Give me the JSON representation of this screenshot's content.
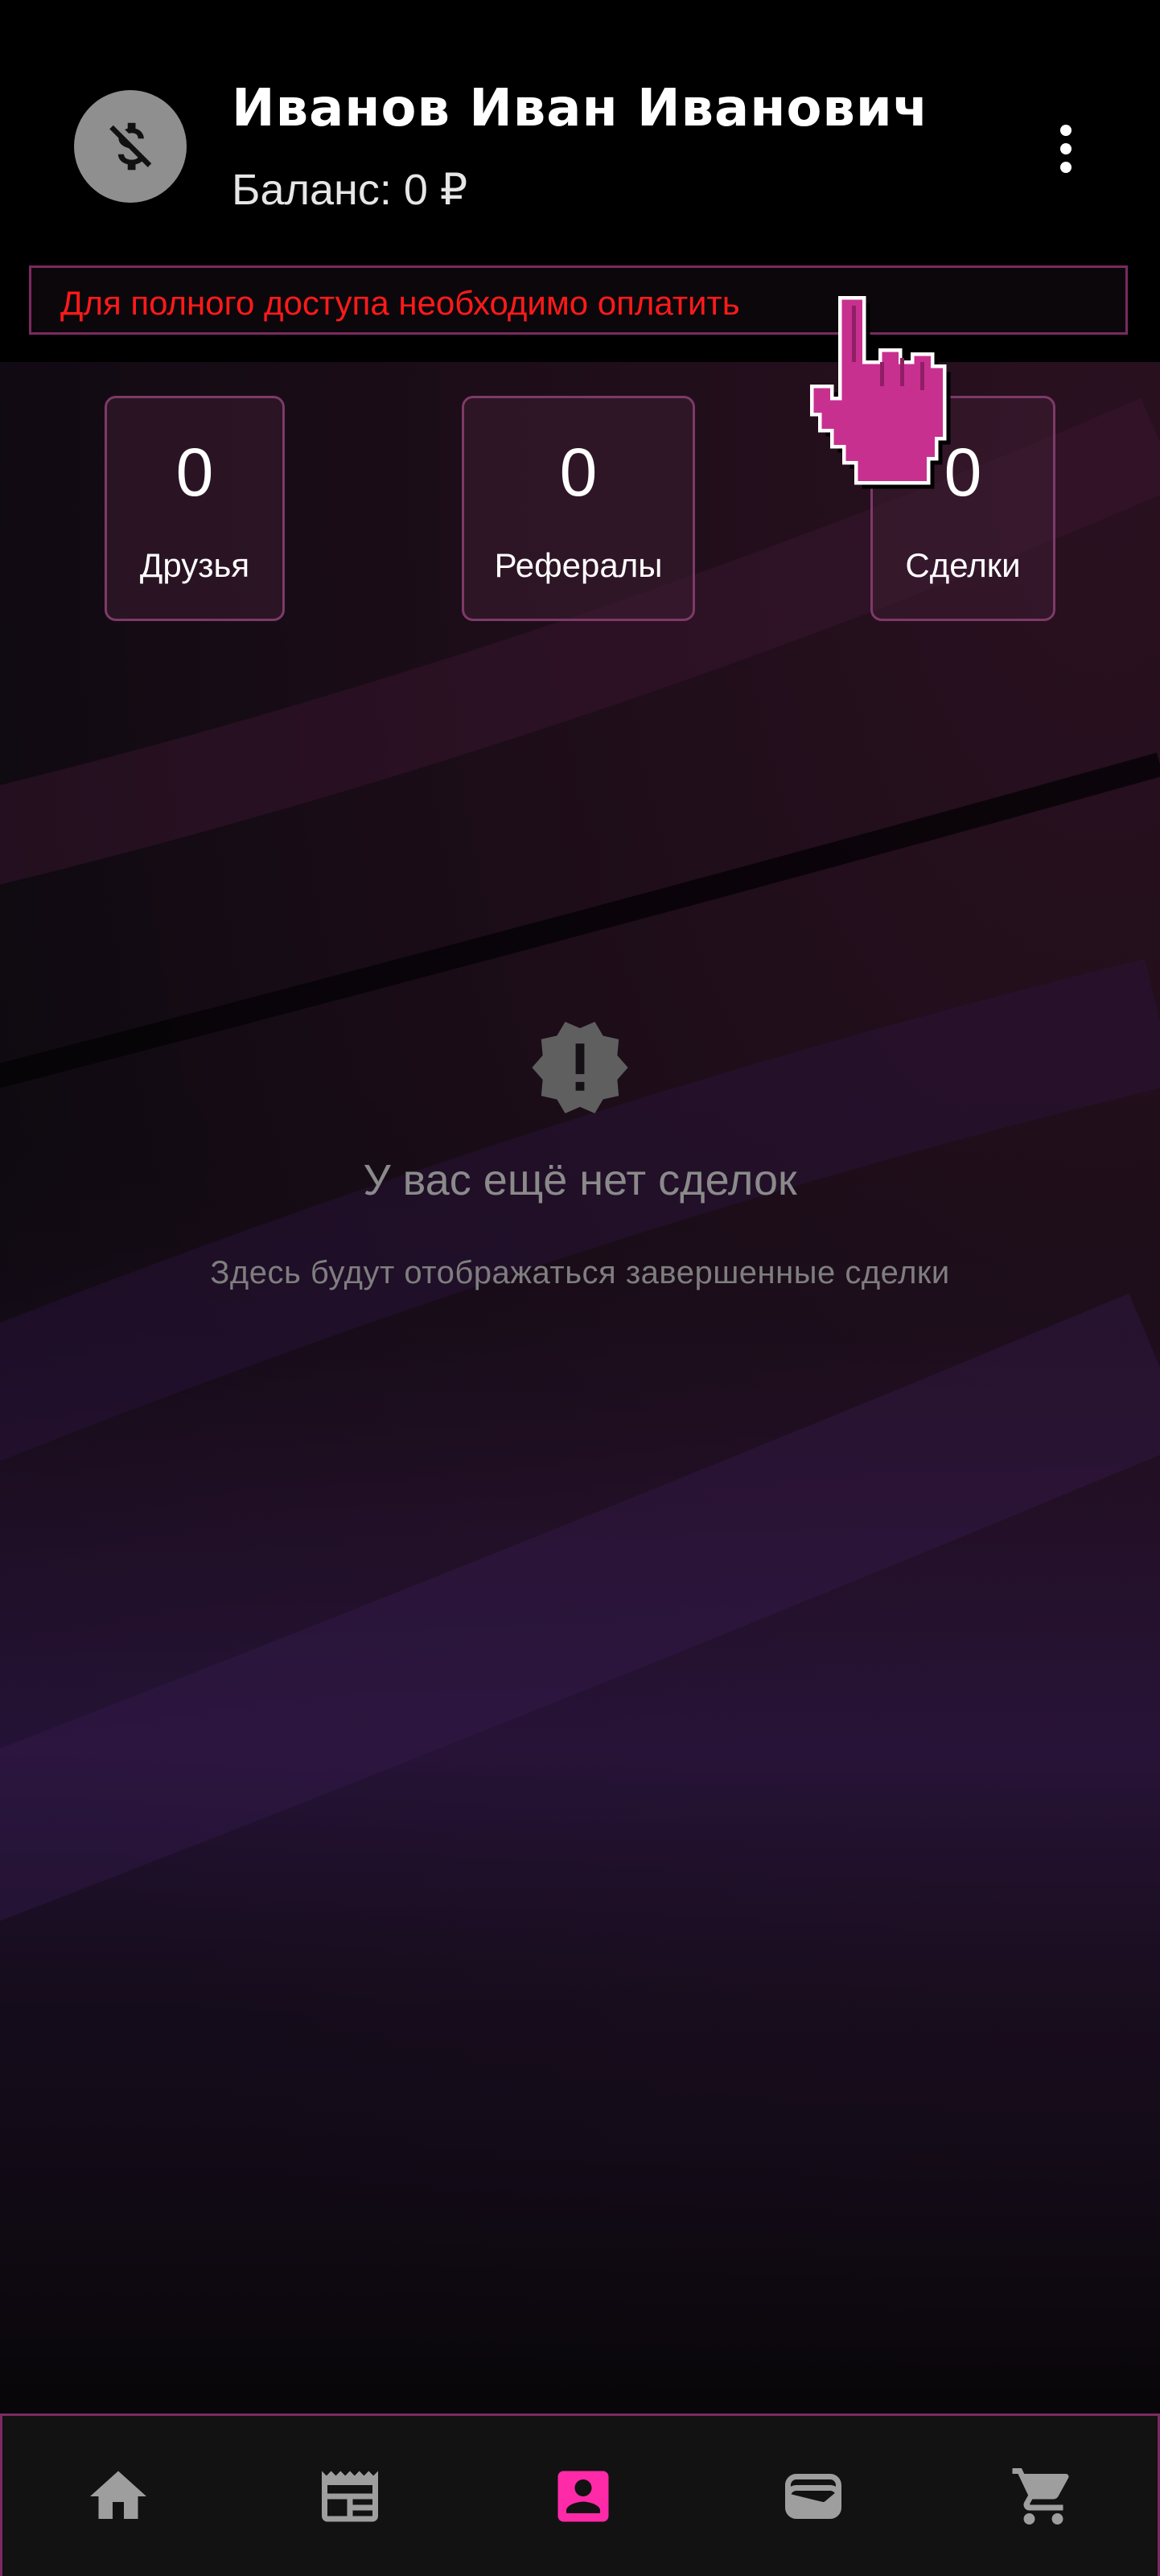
{
  "header": {
    "user_name": "Иванов Иван Иванович",
    "balance": "Баланс: 0 ₽",
    "avatar_icon": "no-money-icon",
    "menu_icon": "more-vertical-icon"
  },
  "notice": {
    "text": "Для полного доступа необходимо оплатить",
    "color": "#ff1a1a"
  },
  "stats": [
    {
      "value": "0",
      "label": "Друзья"
    },
    {
      "value": "0",
      "label": "Рефералы"
    },
    {
      "value": "0",
      "label": "Сделки"
    }
  ],
  "empty_state": {
    "icon": "alert-badge-icon",
    "title": "У вас ещё нет сделок",
    "subtitle": "Здесь будут отображаться завершенные сделки"
  },
  "bottom_nav": {
    "items": [
      {
        "icon": "home-icon",
        "active": false
      },
      {
        "icon": "newspaper-icon",
        "active": false
      },
      {
        "icon": "account-box-icon",
        "active": true
      },
      {
        "icon": "wallet-icon",
        "active": false
      },
      {
        "icon": "cart-icon",
        "active": false
      }
    ],
    "active_color": "#ff2aa8",
    "inactive_color": "#9e9e9e"
  },
  "colors": {
    "accent_border": "#7d2a63",
    "header_bg": "#000000"
  }
}
